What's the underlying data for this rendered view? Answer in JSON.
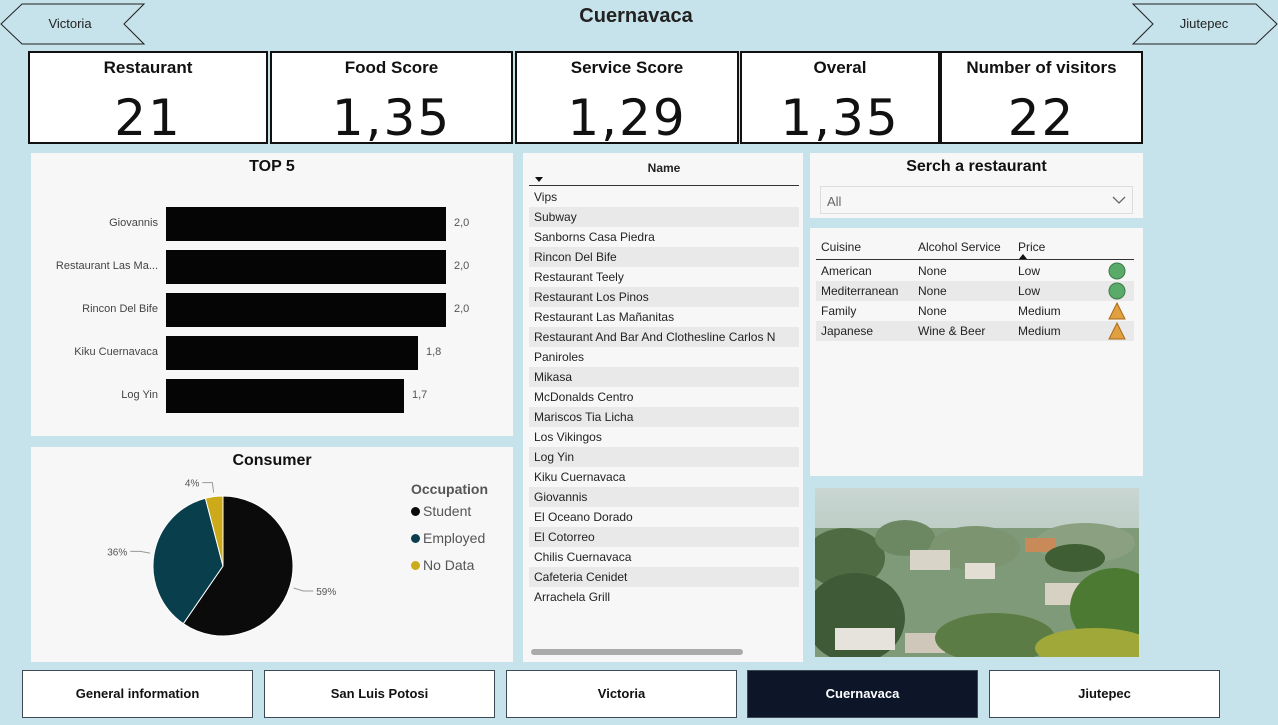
{
  "header": {
    "title": "Cuernavaca",
    "prev_city": "Victoria",
    "next_city": "Jiutepec"
  },
  "kpis": [
    {
      "label": "Restaurant",
      "value": "21"
    },
    {
      "label": "Food Score",
      "value": "1,35"
    },
    {
      "label": "Service Score",
      "value": "1,29"
    },
    {
      "label": "Overal",
      "value": "1,35"
    },
    {
      "label": "Number of visitors",
      "value": "22"
    }
  ],
  "top5": {
    "title": "TOP 5",
    "value_labels": [
      "2,0",
      "2,0",
      "2,0",
      "1,8",
      "1,7"
    ]
  },
  "consumer": {
    "title": "Consumer",
    "legend_title": "Occupation",
    "slice_labels": [
      "59%",
      "36%",
      "4%"
    ]
  },
  "chart_data": [
    {
      "type": "bar",
      "title": "TOP 5",
      "categories": [
        "Giovannis",
        "Restaurant Las Ma...",
        "Rincon Del Bife",
        "Kiku Cuernavaca",
        "Log Yin"
      ],
      "values": [
        2.0,
        2.0,
        2.0,
        1.8,
        1.7
      ],
      "xlim": [
        0,
        2.0
      ],
      "colors": [
        "#050505"
      ]
    },
    {
      "type": "pie",
      "title": "Consumer",
      "legend_title": "Occupation",
      "categories": [
        "Student",
        "Employed",
        "No Data"
      ],
      "values": [
        59,
        36,
        4
      ],
      "colors": [
        "#0b0b0b",
        "#093f4c",
        "#ccaa1a"
      ],
      "legend_placement": "right"
    }
  ],
  "restaurant_list": {
    "header": "Name",
    "items": [
      "Vips",
      "Subway",
      "Sanborns Casa Piedra",
      "Rincon Del Bife",
      "Restaurant Teely",
      "Restaurant Los Pinos",
      "Restaurant Las Mañanitas",
      "Restaurant And Bar And Clothesline Carlos N",
      "Paniroles",
      "Mikasa",
      "McDonalds Centro",
      "Mariscos Tia Licha",
      "Los Vikingos",
      "Log Yin",
      "Kiku Cuernavaca",
      "Giovannis",
      "El Oceano Dorado",
      "El Cotorreo",
      "Chilis Cuernavaca",
      "Cafeteria Cenidet",
      "Arrachela Grill"
    ]
  },
  "search": {
    "title": "Serch a restaurant",
    "selected": "All"
  },
  "details_table": {
    "headers": [
      "Cuisine",
      "Alcohol Service",
      "Price"
    ],
    "rows": [
      {
        "cuisine": "American",
        "alcohol": "None",
        "price": "Low",
        "indicator": "green-circle-icon"
      },
      {
        "cuisine": "Mediterranean",
        "alcohol": "None",
        "price": "Low",
        "indicator": "green-circle-icon"
      },
      {
        "cuisine": "Family",
        "alcohol": "None",
        "price": "Medium",
        "indicator": "orange-triangle-icon"
      },
      {
        "cuisine": "Japanese",
        "alcohol": "Wine & Beer",
        "price": "Medium",
        "indicator": "orange-triangle-icon"
      }
    ],
    "indicator_colors": {
      "low": "#5aaa6a",
      "medium": "#e0a040"
    }
  },
  "tabs": [
    {
      "label": "General information",
      "active": false
    },
    {
      "label": "San Luis Potosi",
      "active": false
    },
    {
      "label": "Victoria",
      "active": false
    },
    {
      "label": "Cuernavaca",
      "active": true
    },
    {
      "label": "Jiutepec",
      "active": false
    }
  ],
  "colors": {
    "background": "#c6e2ea",
    "active_tab": "#0c1628"
  }
}
